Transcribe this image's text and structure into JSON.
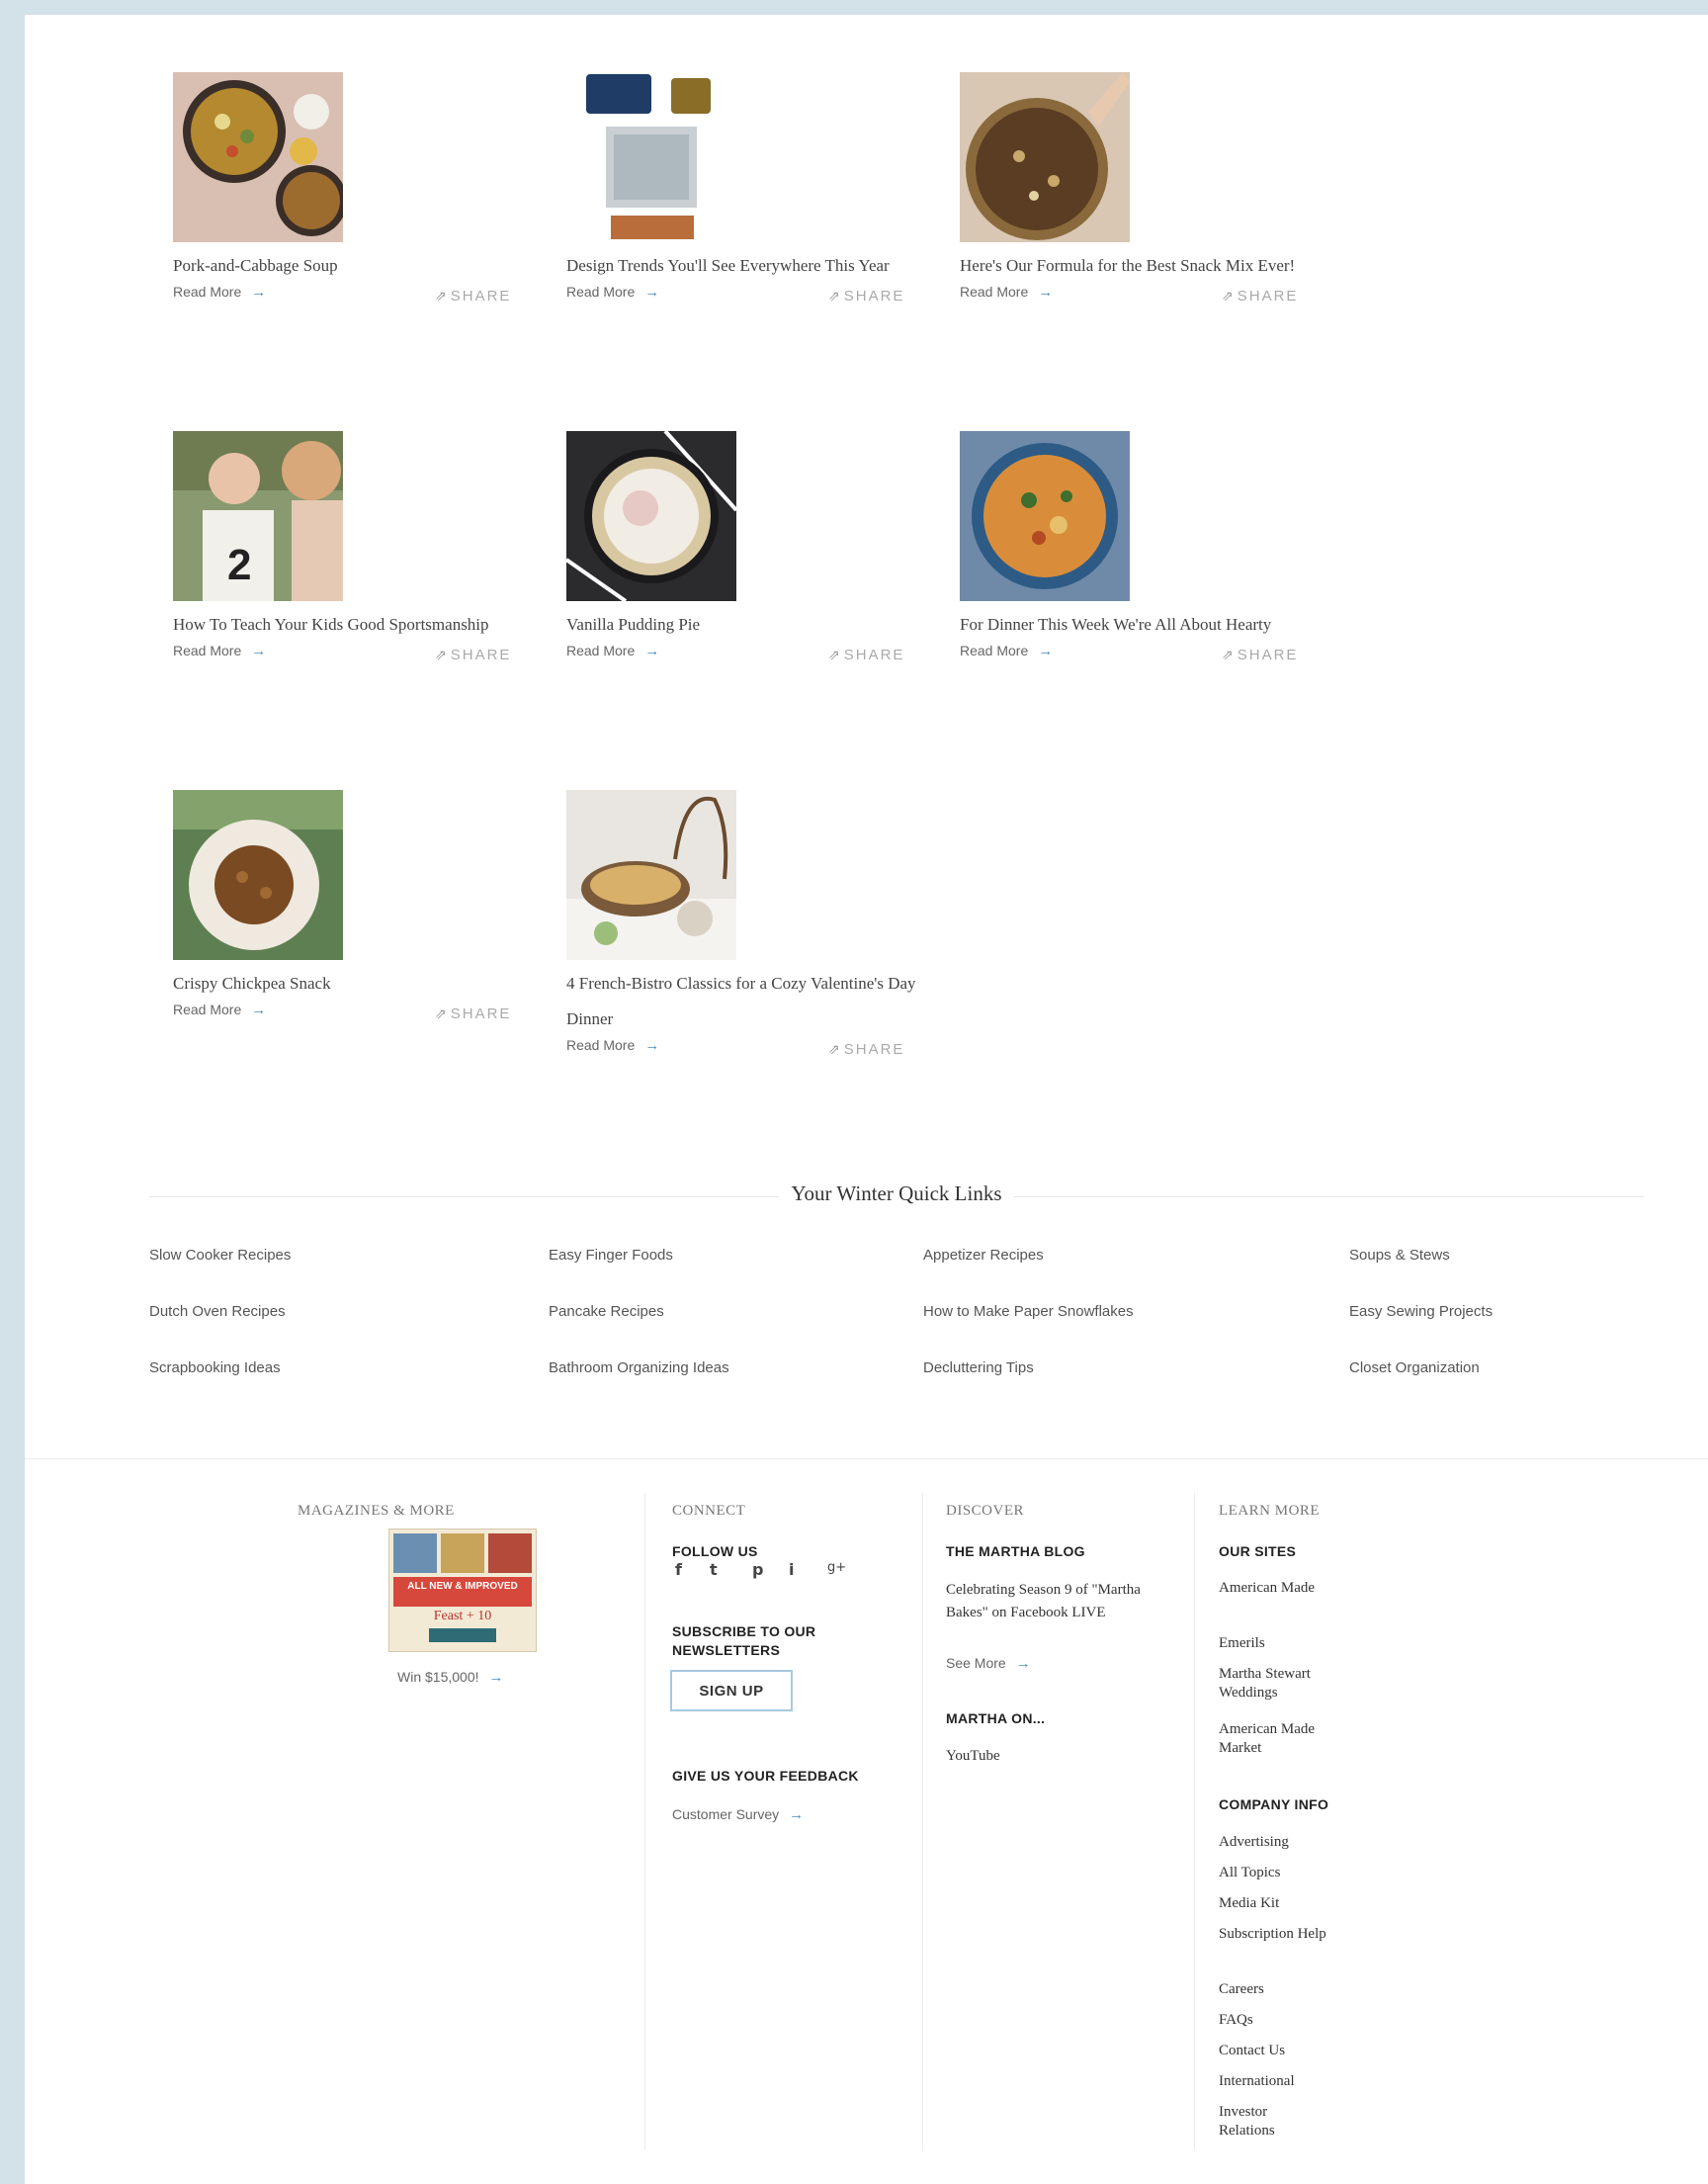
{
  "articles": [
    {
      "title": "Pork-and-Cabbage Soup",
      "read_more": "Read More",
      "share": "SHARE"
    },
    {
      "title": "Design Trends You'll See Everywhere This Year",
      "read_more": "Read More",
      "share": "SHARE"
    },
    {
      "title": "Here's Our Formula for the Best Snack Mix Ever!",
      "read_more": "Read More",
      "share": "SHARE"
    },
    {
      "title": "How To Teach Your Kids Good Sportsmanship",
      "read_more": "Read More",
      "share": "SHARE"
    },
    {
      "title": "Vanilla Pudding Pie",
      "read_more": "Read More",
      "share": "SHARE"
    },
    {
      "title": "For Dinner This Week We're All About Hearty",
      "read_more": "Read More",
      "share": "SHARE"
    },
    {
      "title": "Crispy Chickpea Snack",
      "read_more": "Read More",
      "share": "SHARE"
    },
    {
      "title": "4 French-Bistro Classics for a Cozy Valentine's Day Dinner",
      "read_more": "Read More",
      "share": "SHARE"
    }
  ],
  "quick_links": {
    "title": "Your Winter Quick Links",
    "links": [
      "Slow Cooker Recipes",
      "Easy Finger Foods",
      "Appetizer Recipes",
      "Soups & Stews",
      "Dutch Oven Recipes",
      "Pancake Recipes",
      "How to Make Paper Snowflakes",
      "Easy Sewing Projects",
      "Scrapbooking Ideas",
      "Bathroom Organizing Ideas",
      "Decluttering Tips",
      "Closet Organization"
    ]
  },
  "footer": {
    "magazines": {
      "heading": "MAGAZINES & MORE",
      "cover_headline": "ALL NEW & IMPROVED",
      "cover_sub": "Feast + 10",
      "win_text": "Win $15,000!"
    },
    "connect": {
      "heading": "CONNECT",
      "follow_us": "FOLLOW US",
      "social": [
        "f",
        "t",
        "p",
        "i",
        "g+"
      ],
      "subscribe": "SUBSCRIBE TO OUR NEWSLETTERS",
      "signup": "SIGN UP",
      "feedback": "GIVE US YOUR FEEDBACK",
      "survey": "Customer Survey"
    },
    "discover": {
      "heading": "DISCOVER",
      "blog_title": "THE MARTHA BLOG",
      "blog_text": "Celebrating Season 9 of \"Martha Bakes\" on Facebook LIVE",
      "see_more": "See More",
      "martha_on": "MARTHA ON...",
      "youtube": "YouTube"
    },
    "learn_more": {
      "heading": "LEARN MORE",
      "our_sites": "OUR SITES",
      "sites": [
        "American Made",
        "Emerils",
        "Martha Stewart Weddings",
        "American Made Market"
      ],
      "company_info": "COMPANY INFO",
      "company_links": [
        "Advertising",
        "All Topics",
        "Media Kit",
        "Subscription Help",
        "Careers",
        "FAQs",
        "Contact Us",
        "International",
        "Investor Relations"
      ]
    }
  },
  "icons": {
    "arrow": "→",
    "share": "⇗"
  },
  "colors": {
    "accent": "#4a8ec2",
    "page_bg": "#d3e1e8"
  }
}
